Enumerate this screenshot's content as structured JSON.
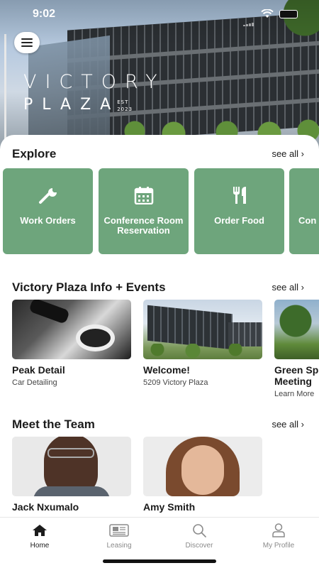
{
  "status_bar": {
    "time": "9:02"
  },
  "brand": {
    "line1": "VICTORY",
    "line2": "PLAZA",
    "est_label": "EST",
    "est_year": "2023"
  },
  "explore": {
    "title": "Explore",
    "see_all": "see all",
    "tiles": [
      {
        "label": "Work Orders",
        "icon": "wrench-icon"
      },
      {
        "label": "Conference Room Reservation",
        "icon": "calendar-icon"
      },
      {
        "label": "Order Food",
        "icon": "fork-knife-icon"
      },
      {
        "label": "Con Onsi",
        "icon": "none"
      }
    ]
  },
  "info": {
    "title": "Victory Plaza Info + Events",
    "see_all": "see all",
    "cards": [
      {
        "title": "Peak Detail",
        "subtitle": "Car Detailing"
      },
      {
        "title": "Welcome!",
        "subtitle": "5209 Victory Plaza"
      },
      {
        "title": "Green Sp Meeting",
        "subtitle": "Learn More"
      }
    ]
  },
  "team": {
    "title": "Meet the Team",
    "see_all": "see all",
    "members": [
      {
        "name": "Jack Nxumalo"
      },
      {
        "name": "Amy Smith"
      }
    ]
  },
  "tabs": [
    {
      "label": "Home",
      "icon": "home-icon",
      "active": true
    },
    {
      "label": "Leasing",
      "icon": "newspaper-icon",
      "active": false
    },
    {
      "label": "Discover",
      "icon": "search-icon",
      "active": false
    },
    {
      "label": "My Profile",
      "icon": "person-icon",
      "active": false
    }
  ],
  "colors": {
    "tile_green": "#6ea57c",
    "text": "#1b1b1b",
    "tab_inactive": "#8a8a8a"
  }
}
